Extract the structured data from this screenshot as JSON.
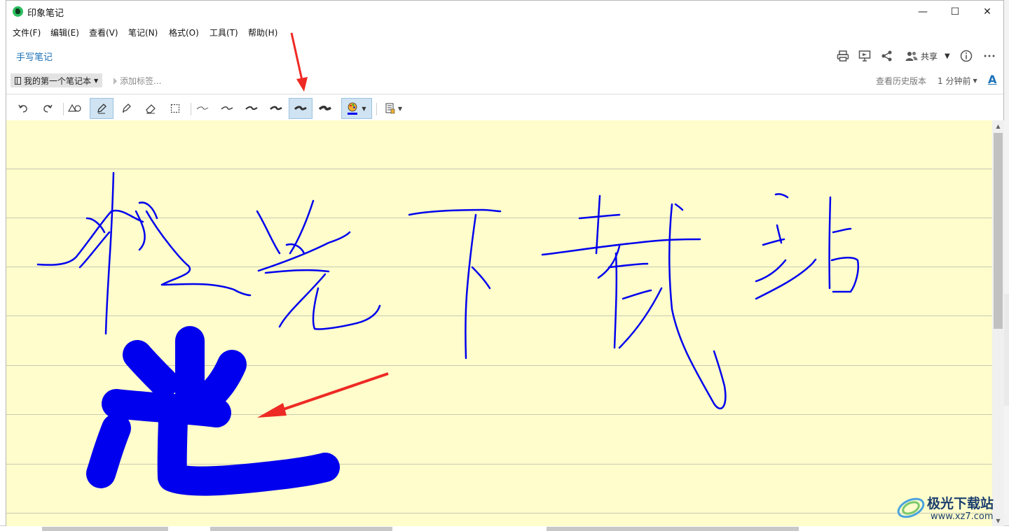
{
  "window": {
    "title": "印象笔记",
    "minimize": "—",
    "maximize": "☐",
    "close": "✕"
  },
  "menu": [
    "文件(F)",
    "编辑(E)",
    "查看(V)",
    "笔记(N)",
    "格式(O)",
    "工具(T)",
    "帮助(H)"
  ],
  "note_header": {
    "type_label": "手写笔记",
    "share_label": "共享",
    "icons": [
      "print-icon",
      "present-icon",
      "share-icon",
      "people-icon",
      "info-icon",
      "more-icon"
    ]
  },
  "info_bar": {
    "notebook": "我的第一个笔记本",
    "add_tag": "添加标签...",
    "history": "查看历史版本",
    "time": "1 分钟前",
    "font_icon": "A"
  },
  "toolbar": {
    "tools": [
      "undo",
      "redo",
      "shapes",
      "pen",
      "highlighter",
      "eraser",
      "lasso-select"
    ],
    "active_tool": "pen",
    "stroke_widths": [
      "1",
      "2",
      "3",
      "4",
      "5",
      "6"
    ],
    "active_stroke_width": "5",
    "pen_color": "#0000ee",
    "colors": {
      "active_bg": "#cfe3f2",
      "accent": "#1c72b8",
      "paper": "#fefdcb",
      "ink": "#0000ee",
      "arrow": "#ee2a24"
    }
  },
  "canvas": {
    "handwriting_line1": "极光下载站",
    "handwriting_line2": "光"
  },
  "watermark": {
    "name": "极光下载站",
    "url": "www.xz7.com"
  }
}
